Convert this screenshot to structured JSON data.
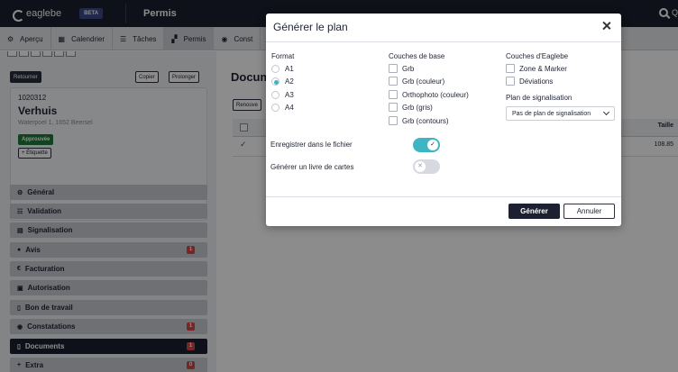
{
  "topbar": {
    "logo": "eaglebe",
    "beta": "BETA",
    "title": "Permis"
  },
  "tabs": [
    {
      "label": "Aperçu",
      "icon": "gear-icon"
    },
    {
      "label": "Calendrier",
      "icon": "calendar-icon"
    },
    {
      "label": "Tâches",
      "icon": "list-icon"
    },
    {
      "label": "Permis",
      "icon": "permit-icon",
      "active": true
    },
    {
      "label": "Const",
      "icon": "eye-icon"
    }
  ],
  "left": {
    "back_label": "Retourner",
    "copy_label": "Copier",
    "extend_label": "Prolonger",
    "permit_number": "1020312",
    "permit_name": "Verhuis",
    "address": "Waterpoel 1, 1652 Beersel",
    "status": "Approuvée",
    "tag_label": "+ Étiquette",
    "nav": [
      {
        "label": "Général",
        "icon": "gear-icon"
      },
      {
        "label": "Validation",
        "icon": "sliders-icon"
      },
      {
        "label": "Signalisation",
        "icon": "signpost-icon"
      },
      {
        "label": "Avis",
        "icon": "chat-icon",
        "count": "1"
      },
      {
        "label": "Facturation",
        "icon": "euro-icon"
      },
      {
        "label": "Autorisation",
        "icon": "clipboard-icon"
      },
      {
        "label": "Bon de travail",
        "icon": "document-icon"
      },
      {
        "label": "Constatations",
        "icon": "eye-icon",
        "count": "1"
      },
      {
        "label": "Documents",
        "icon": "file-icon",
        "count": "1",
        "active": true
      },
      {
        "label": "Extra",
        "icon": "plus-icon",
        "count": "0"
      }
    ]
  },
  "right": {
    "title": "Docum",
    "renew_label": "Renouve",
    "size_header": "Taille",
    "row_size": "108.85"
  },
  "modal": {
    "title": "Générer le plan",
    "format_header": "Format",
    "formats": [
      {
        "label": "A1",
        "selected": false
      },
      {
        "label": "A2",
        "selected": true
      },
      {
        "label": "A3",
        "selected": false
      },
      {
        "label": "A4",
        "selected": false
      }
    ],
    "base_layers_header": "Couches de base",
    "base_layers": [
      {
        "label": "Grb"
      },
      {
        "label": "Grb (couleur)"
      },
      {
        "label": "Orthophoto (couleur)"
      },
      {
        "label": "Grb (gris)"
      },
      {
        "label": "Grb (contours)"
      }
    ],
    "eaglebe_layers_header": "Couches d'Eaglebe",
    "eaglebe_layers": [
      {
        "label": "Zone & Marker"
      },
      {
        "label": "Déviations"
      }
    ],
    "signal_plan_header": "Plan de signalisation",
    "signal_plan_value": "Pas de plan de signalisation",
    "save_in_file_label": "Enregistrer dans le fichier",
    "save_in_file": true,
    "map_book_label": "Générer un livre de cartes",
    "map_book": false,
    "generate_label": "Générer",
    "cancel_label": "Annuler",
    "accent": "#3fb5c4"
  }
}
